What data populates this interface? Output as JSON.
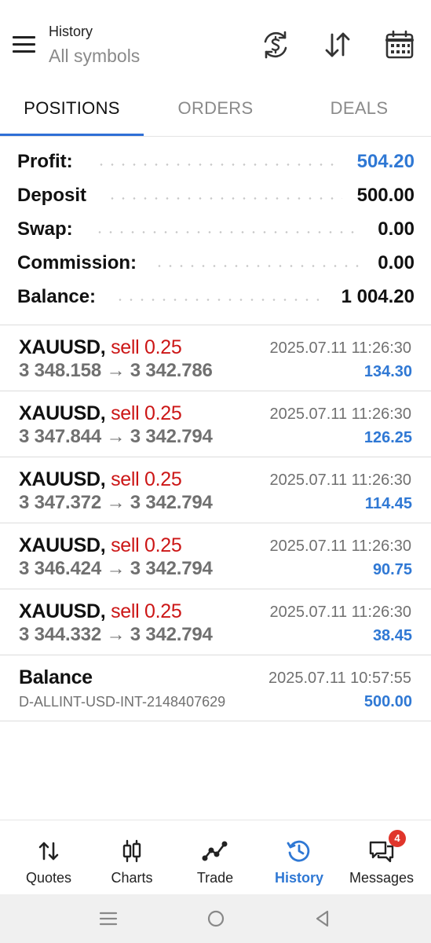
{
  "header": {
    "title": "History",
    "subtitle": "All symbols"
  },
  "tabs": [
    {
      "label": "POSITIONS",
      "active": true
    },
    {
      "label": "ORDERS",
      "active": false
    },
    {
      "label": "DEALS",
      "active": false
    }
  ],
  "summary": {
    "profit_label": "Profit:",
    "profit_value": "504.20",
    "deposit_label": "Deposit",
    "deposit_value": "500.00",
    "swap_label": "Swap:",
    "swap_value": "0.00",
    "commission_label": "Commission:",
    "commission_value": "0.00",
    "balance_label": "Balance:",
    "balance_value": "1 004.20"
  },
  "trades": [
    {
      "symbol": "XAUUSD,",
      "side": "sell 0.25",
      "open": "3 348.158",
      "arrow": "→",
      "close": "3 342.786",
      "time": "2025.07.11 11:26:30",
      "profit": "134.30"
    },
    {
      "symbol": "XAUUSD,",
      "side": "sell 0.25",
      "open": "3 347.844",
      "arrow": "→",
      "close": "3 342.794",
      "time": "2025.07.11 11:26:30",
      "profit": "126.25"
    },
    {
      "symbol": "XAUUSD,",
      "side": "sell 0.25",
      "open": "3 347.372",
      "arrow": "→",
      "close": "3 342.794",
      "time": "2025.07.11 11:26:30",
      "profit": "114.45"
    },
    {
      "symbol": "XAUUSD,",
      "side": "sell 0.25",
      "open": "3 346.424",
      "arrow": "→",
      "close": "3 342.794",
      "time": "2025.07.11 11:26:30",
      "profit": "90.75"
    },
    {
      "symbol": "XAUUSD,",
      "side": "sell 0.25",
      "open": "3 344.332",
      "arrow": "→",
      "close": "3 342.794",
      "time": "2025.07.11 11:26:30",
      "profit": "38.45"
    }
  ],
  "balance_entry": {
    "title": "Balance",
    "account": "D-ALLINT-USD-INT-2148407629",
    "time": "2025.07.11 10:57:55",
    "amount": "500.00"
  },
  "nav": {
    "quotes": "Quotes",
    "charts": "Charts",
    "trade": "Trade",
    "history": "History",
    "messages": "Messages",
    "messages_badge": "4"
  },
  "icons": {
    "menu": "hamburger-icon",
    "currency": "currency-exchange-icon",
    "sort": "sort-arrows-icon",
    "calendar": "calendar-icon"
  },
  "colors": {
    "accent": "#2f78d4",
    "sell": "#cc1616",
    "badge": "#e0352b"
  }
}
